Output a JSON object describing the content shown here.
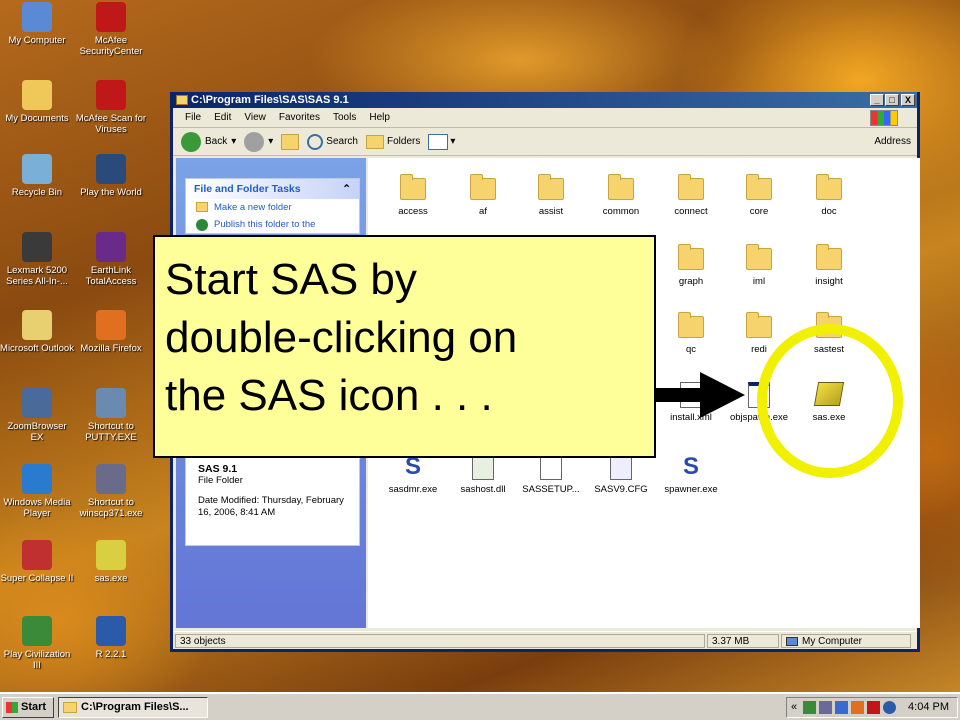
{
  "desktop": {
    "icons": [
      {
        "label": "My Computer",
        "color": "#5a8ad6"
      },
      {
        "label": "McAfee SecurityCenter",
        "color": "#c01818"
      },
      {
        "label": "My Documents",
        "color": "#f0c85a"
      },
      {
        "label": "McAfee Scan for Viruses",
        "color": "#c01818"
      },
      {
        "label": "Recycle Bin",
        "color": "#7ab0d8"
      },
      {
        "label": "Play the World",
        "color": "#2a4a7a"
      },
      {
        "label": "Lexmark 5200 Series All-In-...",
        "color": "#3a3a3a"
      },
      {
        "label": "EarthLink TotalAccess",
        "color": "#6a2a8a"
      },
      {
        "label": "Microsoft Outlook",
        "color": "#e8d070"
      },
      {
        "label": "Mozilla Firefox",
        "color": "#e07020"
      },
      {
        "label": "ZoomBrowser EX",
        "color": "#4a6a9a"
      },
      {
        "label": "Shortcut to PUTTY.EXE",
        "color": "#6a8ab0"
      },
      {
        "label": "Windows Media Player",
        "color": "#2a7ad0"
      },
      {
        "label": "Shortcut to winscp371.exe",
        "color": "#6a6a8a"
      },
      {
        "label": "Super Collapse II",
        "color": "#c03030"
      },
      {
        "label": "sas.exe",
        "color": "#d8d040"
      },
      {
        "label": "Play Civilization III",
        "color": "#3a8a3a"
      },
      {
        "label": "R 2.2.1",
        "color": "#2a5aa8"
      }
    ]
  },
  "window": {
    "title": "C:\\Program Files\\SAS\\SAS 9.1",
    "buttons": {
      "minimize": "_",
      "maximize": "□",
      "close": "X"
    },
    "menu": [
      "File",
      "Edit",
      "View",
      "Favorites",
      "Tools",
      "Help"
    ],
    "toolbar": {
      "back": "Back",
      "search": "Search",
      "folders": "Folders",
      "address": "Address"
    },
    "tasks": {
      "header": "File and Folder Tasks",
      "collapse_glyph": "⌃",
      "items": [
        "Make a new folder",
        "Publish this folder to the"
      ]
    },
    "details": {
      "name": "SAS 9.1",
      "type": "File Folder",
      "modified": "Date Modified: Thursday, February 16, 2006, 8:41 AM"
    },
    "files": {
      "row1": [
        "access",
        "af",
        "assist",
        "common",
        "connect",
        "core",
        "doc"
      ],
      "row2": [
        "graph",
        "iml",
        "insight"
      ],
      "row3": [
        "qc",
        "redi",
        "sastest"
      ],
      "row4": [
        "install.xml",
        "objspawn.exe",
        "sas.exe"
      ],
      "row5": [
        "sasdmr.exe",
        "sashost.dll",
        "SASSETUP...",
        "SASV9.CFG",
        "spawner.exe"
      ]
    },
    "status": {
      "count": "33 objects",
      "size": "3.37 MB",
      "location": "My Computer"
    }
  },
  "callout": {
    "line1": "Start SAS by",
    "line2": "double-clicking on",
    "line3": "the SAS icon . . ."
  },
  "colors": {
    "highlight_ring": "#f0f000",
    "arrow": "#000000",
    "callout_bg": "#ffff99"
  },
  "taskbar": {
    "start": "Start",
    "task": "C:\\Program Files\\S...",
    "clock": "4:04 PM",
    "tray_chevron": "«"
  }
}
